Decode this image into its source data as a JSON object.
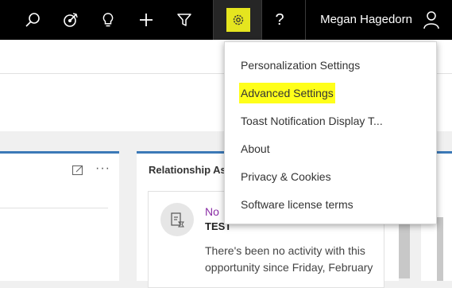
{
  "header": {
    "user_name": "Megan Hagedorn",
    "icons": [
      "search-icon",
      "target-icon",
      "lightbulb-icon",
      "plus-icon",
      "filter-icon",
      "gear-icon",
      "help-icon",
      "user-icon"
    ],
    "help_glyph": "?",
    "settings_highlight_color": "#e5e51f"
  },
  "settings_menu": {
    "items": [
      {
        "label": "Personalization Settings"
      },
      {
        "label": "Advanced Settings",
        "highlighted": true
      },
      {
        "label": "Toast Notification Display T..."
      },
      {
        "label": "About"
      },
      {
        "label": "Privacy & Cookies"
      },
      {
        "label": "Software license terms"
      }
    ]
  },
  "left_panel": {
    "more_glyph": "···"
  },
  "relationship_panel": {
    "title": "Relationship As",
    "card": {
      "kind": "No",
      "title": "TEST",
      "description": "There's been no activity with this opportunity since Friday, February"
    }
  },
  "colors": {
    "panel_accent": "#3b79b7",
    "card_kind": "#8a2da5",
    "menu_highlight": "#ffff1a"
  }
}
